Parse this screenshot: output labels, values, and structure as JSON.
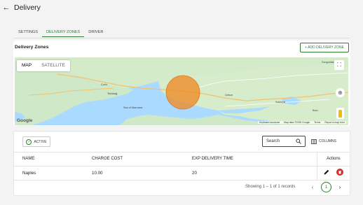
{
  "header": {
    "title": "Delivery",
    "back_icon": "arrow-left-icon"
  },
  "tabs": [
    {
      "label": "SETTINGS",
      "active": false
    },
    {
      "label": "DELIVERY ZONES",
      "active": true
    },
    {
      "label": "DRIVER",
      "active": false
    }
  ],
  "zones_card": {
    "title": "Delivery Zones",
    "add_button": "+ ADD DELIVERY ZONE"
  },
  "map": {
    "toggle": [
      "MAP",
      "SATELLITE"
    ],
    "selected": "MAP",
    "places": [
      "Çorlu",
      "Tekirdağ",
      "Sea of Marmara",
      "Gebze",
      "Zonguldak",
      "Bolu",
      "Sakarya"
    ],
    "google_logo": "Google",
    "attribution": [
      "Keyboard shortcuts",
      "Map data ©2025 Google",
      "Terms",
      "Report a map error"
    ],
    "zone_color": "#f08a24",
    "water_color": "#aadaff",
    "land_color": "#cfe8c8"
  },
  "table": {
    "filter_button": "ACTIVE",
    "search_placeholder": "Search",
    "columns_button": "COLUMNS",
    "headers": {
      "name": "NAME",
      "charge_cost": "CHARGE COST",
      "exp_delivery_time": "EXP DELIVERY TIME",
      "actions": "Actions"
    },
    "rows": [
      {
        "name": "Naples",
        "charge_cost": "10.00",
        "exp_delivery_time": "20"
      }
    ],
    "pagination": {
      "summary": "Showing 1 – 1 of 1 records",
      "current_page": "1"
    }
  },
  "colors": {
    "accent": "#2e7d32",
    "danger": "#d32f2f",
    "background": "#f2f3f2"
  }
}
